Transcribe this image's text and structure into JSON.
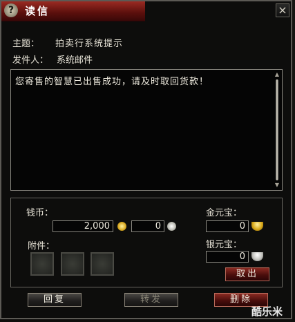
{
  "window": {
    "title": "读信"
  },
  "header": {
    "subject_label": "主题：",
    "subject_value": "拍卖行系统提示",
    "sender_label": "发件人：",
    "sender_value": "系统邮件"
  },
  "message": {
    "body": "您寄售的智慧已出售成功，请及时取回货款！"
  },
  "money": {
    "label": "钱币：",
    "gold_value": "2,000",
    "silver_value": "0"
  },
  "attachments": {
    "label": "附件：",
    "slot_count": 3
  },
  "ingots": {
    "gold_label": "金元宝：",
    "gold_value": "0",
    "silver_label": "银元宝：",
    "silver_value": "0",
    "take_out_label": "取出"
  },
  "actions": {
    "reply_label": "回复",
    "forward_label": "转发",
    "delete_label": "删除"
  },
  "watermark": {
    "text": "酷乐米"
  },
  "icons": {
    "help": "help-icon",
    "close": "close-icon",
    "gold_coin": "gold-coin-icon",
    "silver_coin": "silver-coin-icon",
    "gold_ingot": "gold-ingot-icon",
    "silver_ingot": "silver-ingot-icon"
  },
  "colors": {
    "title_bar": "#7a1a14",
    "delete_button": "#6a1410",
    "text": "#e6e2d6"
  }
}
